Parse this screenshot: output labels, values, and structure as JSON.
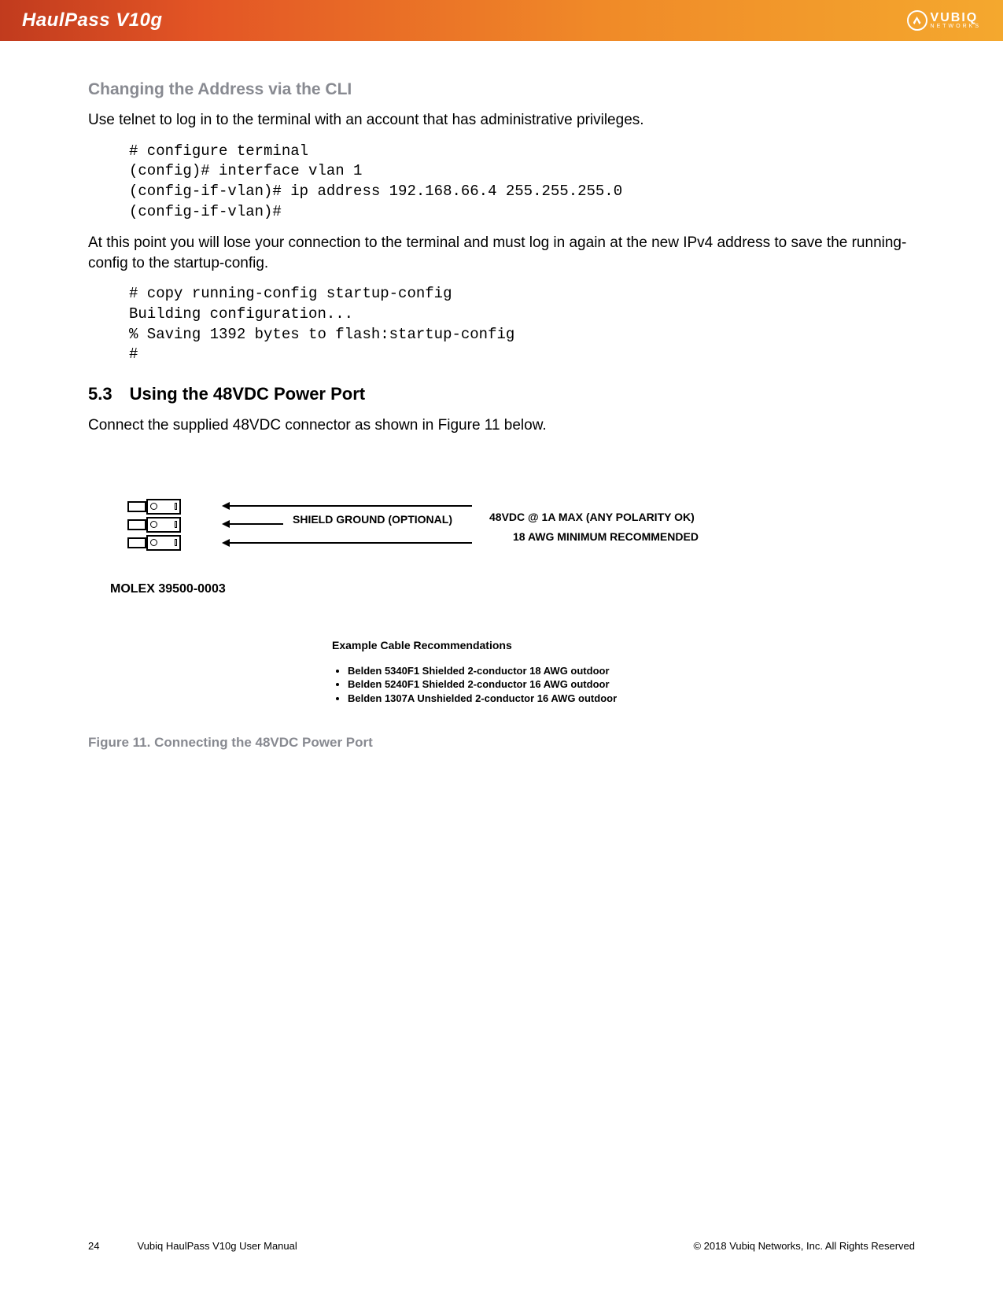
{
  "header": {
    "product": "HaulPass V10g",
    "vendor_main": "VUBIQ",
    "vendor_sub": "NETWORKS"
  },
  "section": {
    "subtitle": "Changing the Address via the CLI",
    "intro": "Use telnet to log in to the terminal with an account that has administrative privileges.",
    "code1": "# configure terminal\n(config)# interface vlan 1\n(config-if-vlan)# ip address 192.168.66.4 255.255.255.0\n(config-if-vlan)#",
    "para2": "At this point you will lose your connection to the terminal and must log in again at the new IPv4 address to save the running-config to the startup-config.",
    "code2": "# copy running-config startup-config\nBuilding configuration...\n% Saving 1392 bytes to flash:startup-config\n#",
    "heading_num": "5.3",
    "heading_text": "Using the 48VDC Power Port",
    "para3": "Connect the supplied 48VDC connector as shown in Figure 11 below.",
    "figure": {
      "shield_label": "SHIELD GROUND (OPTIONAL)",
      "spec1": "48VDC @ 1A MAX (ANY POLARITY OK)",
      "spec2": "18 AWG MINIMUM RECOMMENDED",
      "part": "MOLEX 39500-0003",
      "rec_title": "Example Cable Recommendations",
      "recs": [
        "Belden 5340F1 Shielded 2-conductor 18 AWG outdoor",
        "Belden 5240F1 Shielded 2-conductor 16 AWG outdoor",
        "Belden 1307A Unshielded 2-conductor 16 AWG outdoor"
      ],
      "caption": "Figure 11. Connecting the 48VDC Power Port"
    }
  },
  "footer": {
    "page": "24",
    "doc": "Vubiq HaulPass V10g User Manual",
    "copyright": "© 2018 Vubiq Networks, Inc. All Rights Reserved"
  }
}
